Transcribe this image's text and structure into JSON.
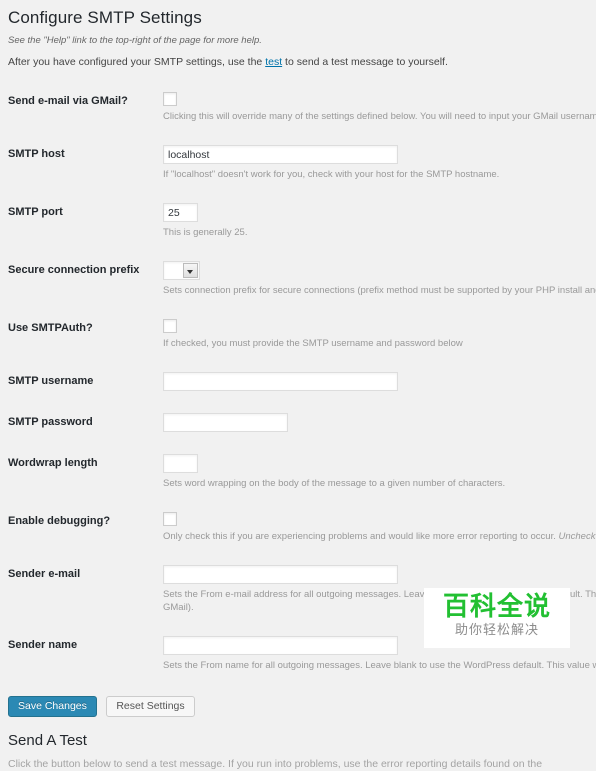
{
  "page": {
    "title": "Configure SMTP Settings",
    "help_note": "See the \"Help\" link to the top-right of the page for more help.",
    "intro_before": "After you have configured your SMTP settings, use the ",
    "intro_link": "test",
    "intro_after": " to send a test message to yourself."
  },
  "fields": {
    "gmail": {
      "label": "Send e-mail via GMail?",
      "type": "checkbox",
      "checked": false,
      "description": "Clicking this will override many of the settings defined below. You will need to input your GMail username and password below."
    },
    "smtp_host": {
      "label": "SMTP host",
      "value": "localhost",
      "description": "If \"localhost\" doesn't work for you, check with your host for the SMTP hostname."
    },
    "smtp_port": {
      "label": "SMTP port",
      "value": "25",
      "description": "This is generally 25."
    },
    "secure_prefix": {
      "label": "Secure connection prefix",
      "value": "",
      "description": "Sets connection prefix for secure connections (prefix method must be supported by your PHP install and your SMTP host)."
    },
    "smtp_auth": {
      "label": "Use SMTPAuth?",
      "type": "checkbox",
      "checked": false,
      "description": "If checked, you must provide the SMTP username and password below"
    },
    "smtp_username": {
      "label": "SMTP username",
      "value": "",
      "description": ""
    },
    "smtp_password": {
      "label": "SMTP password",
      "value": "",
      "description": ""
    },
    "wordwrap": {
      "label": "Wordwrap length",
      "value": "",
      "description": "Sets word wrapping on the body of the message to a given number of characters."
    },
    "debugging": {
      "label": "Enable debugging?",
      "type": "checkbox",
      "checked": false,
      "description": "Only check this if you are experiencing problems and would like more error reporting to occur. ",
      "description_italic": "Uncheck this once you have"
    },
    "sender_email": {
      "label": "Sender e-mail",
      "value": "",
      "description": "Sets the From e-mail address for all outgoing messages. Leave blank to use the WordPress default. This value will be used for GMail)."
    },
    "sender_name": {
      "label": "Sender name",
      "value": "",
      "description": "Sets the From name for all outgoing messages. Leave blank to use the WordPress default. This value will be used even if"
    }
  },
  "buttons": {
    "save": "Save Changes",
    "reset": "Reset Settings"
  },
  "send_test": {
    "title": "Send A Test",
    "description": "Click the button below to send a test message. If you run into problems, use the error reporting details found on the"
  },
  "watermark": {
    "main": "百科全说",
    "sub": "助你轻松解决",
    "color": "#22c032"
  }
}
